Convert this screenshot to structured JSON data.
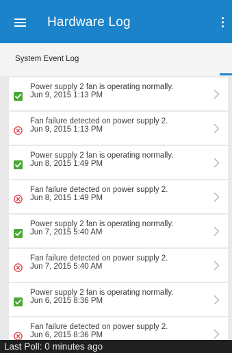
{
  "app_bar": {
    "title": "Hardware Log",
    "background": "#1a83c9",
    "menu_icon": "hamburger-menu-icon",
    "overflow_icon": "more-vert-icon"
  },
  "section": {
    "title": "System Event Log"
  },
  "colors": {
    "ok_green": "#4aa834",
    "error_red": "#e0353f"
  },
  "entries": [
    {
      "status": "ok",
      "message": "Power supply 2 fan is operating normally.",
      "time": "Jun 9, 2015 1:13 PM"
    },
    {
      "status": "error",
      "message": "Fan failure detected on power supply 2.",
      "time": "Jun 9, 2015 1:13 PM"
    },
    {
      "status": "ok",
      "message": "Power supply 2 fan is operating normally.",
      "time": "Jun 8, 2015 1:49 PM"
    },
    {
      "status": "error",
      "message": "Fan failure detected on power supply 2.",
      "time": "Jun 8, 2015 1:49 PM"
    },
    {
      "status": "ok",
      "message": "Power supply 2 fan is operating normally.",
      "time": "Jun 7, 2015 5:40 AM"
    },
    {
      "status": "error",
      "message": "Fan failure detected on power supply 2.",
      "time": "Jun 7, 2015 5:40 AM"
    },
    {
      "status": "ok",
      "message": "Power supply 2 fan is operating normally.",
      "time": "Jun 6, 2015 8:36 PM"
    },
    {
      "status": "error",
      "message": "Fan failure detected on power supply 2.",
      "time": "Jun 6, 2015 8:36 PM"
    }
  ],
  "footer": {
    "text": "Last Poll: 0 minutes ago"
  }
}
